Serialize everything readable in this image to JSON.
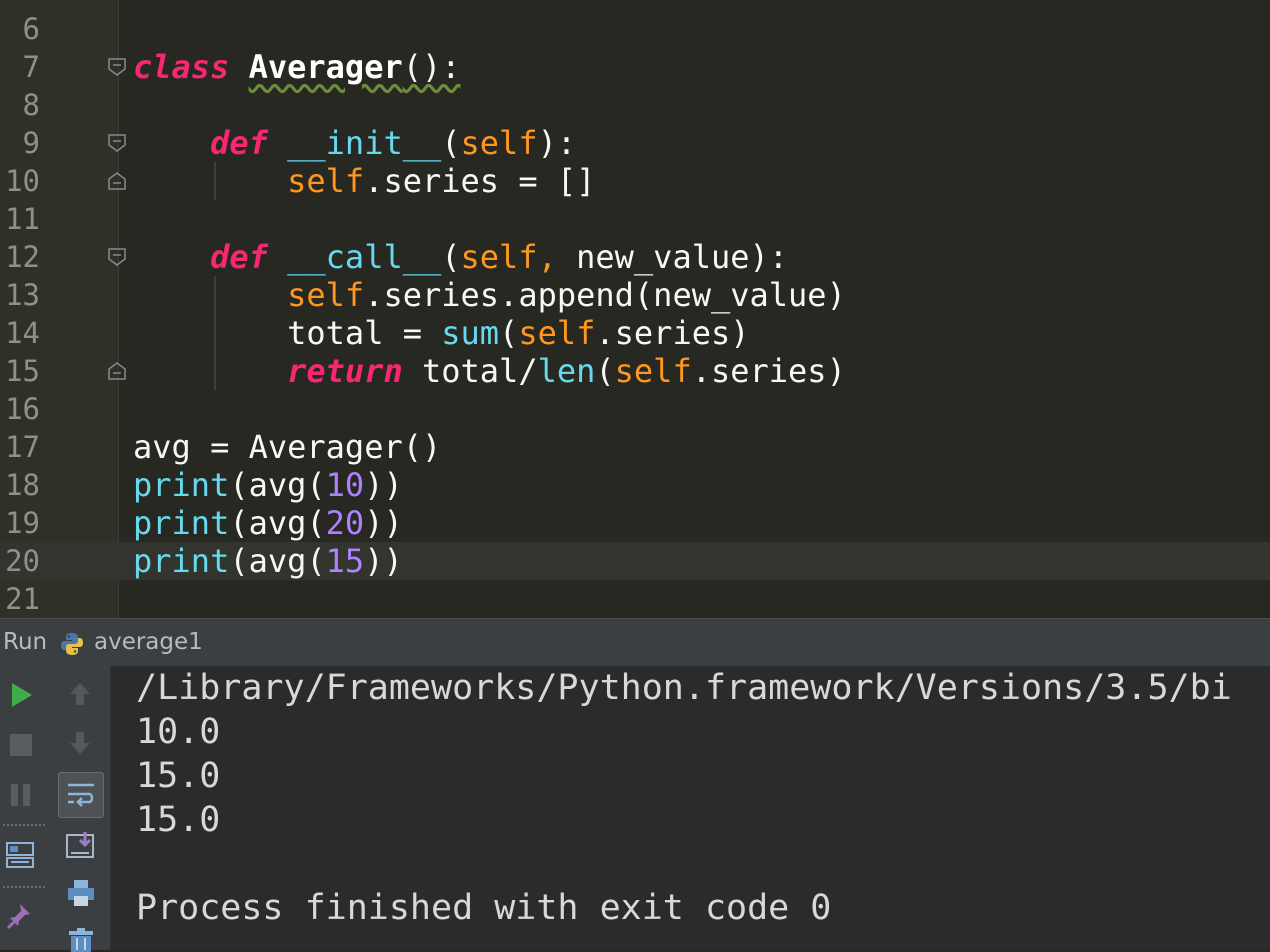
{
  "editor": {
    "line_numbers": [
      "6",
      "7",
      "8",
      "9",
      "10",
      "11",
      "12",
      "13",
      "14",
      "15",
      "16",
      "17",
      "18",
      "19",
      "20",
      "21"
    ],
    "line7": {
      "kw": "class",
      "name": "Averager",
      "rest": "():"
    },
    "line9": {
      "kw": "def",
      "fn": "__init__",
      "p1": "(",
      "self": "self",
      "p2": "):"
    },
    "line10": {
      "self": "self",
      "rest": ".series = []"
    },
    "line12": {
      "kw": "def",
      "fn": "__call__",
      "p1": "(",
      "self": "self,",
      "rest": " new_value):"
    },
    "line13": {
      "self": "self",
      "rest": ".series.append(new_value)"
    },
    "line14": {
      "a": "total = ",
      "fn": "sum",
      "p": "(",
      "self": "self",
      "rest": ".series)"
    },
    "line15": {
      "kw": "return",
      "a": " total/",
      "fn": "len",
      "p": "(",
      "self": "self",
      "rest": ".series)"
    },
    "line17": "avg = Averager()",
    "line18": {
      "fn": "print",
      "a": "(avg(",
      "num": "10",
      "b": "))"
    },
    "line19": {
      "fn": "print",
      "a": "(avg(",
      "num": "20",
      "b": "))"
    },
    "line20": {
      "fn": "print",
      "a": "(avg(",
      "num": "15",
      "b": "))"
    }
  },
  "run_panel": {
    "label": "Run",
    "config_name": "average1",
    "output_lines": [
      "/Library/Frameworks/Python.framework/Versions/3.5/bi",
      "10.0",
      "15.0",
      "15.0",
      "",
      "Process finished with exit code 0"
    ]
  },
  "icons": [
    "fold-open-icon",
    "fold-close-icon",
    "python-icon",
    "run-icon",
    "stop-icon",
    "pause-icon",
    "layout-icon",
    "pin-icon",
    "up-arrow-icon",
    "down-arrow-icon",
    "soft-wrap-icon",
    "scroll-to-end-icon",
    "print-icon",
    "trash-icon"
  ],
  "colors": {
    "editor_bg": "#272822",
    "keyword": "#F92672",
    "function": "#66D9EF",
    "self": "#FD971F",
    "number": "#AE81FF",
    "run_green": "#3FAE49"
  }
}
